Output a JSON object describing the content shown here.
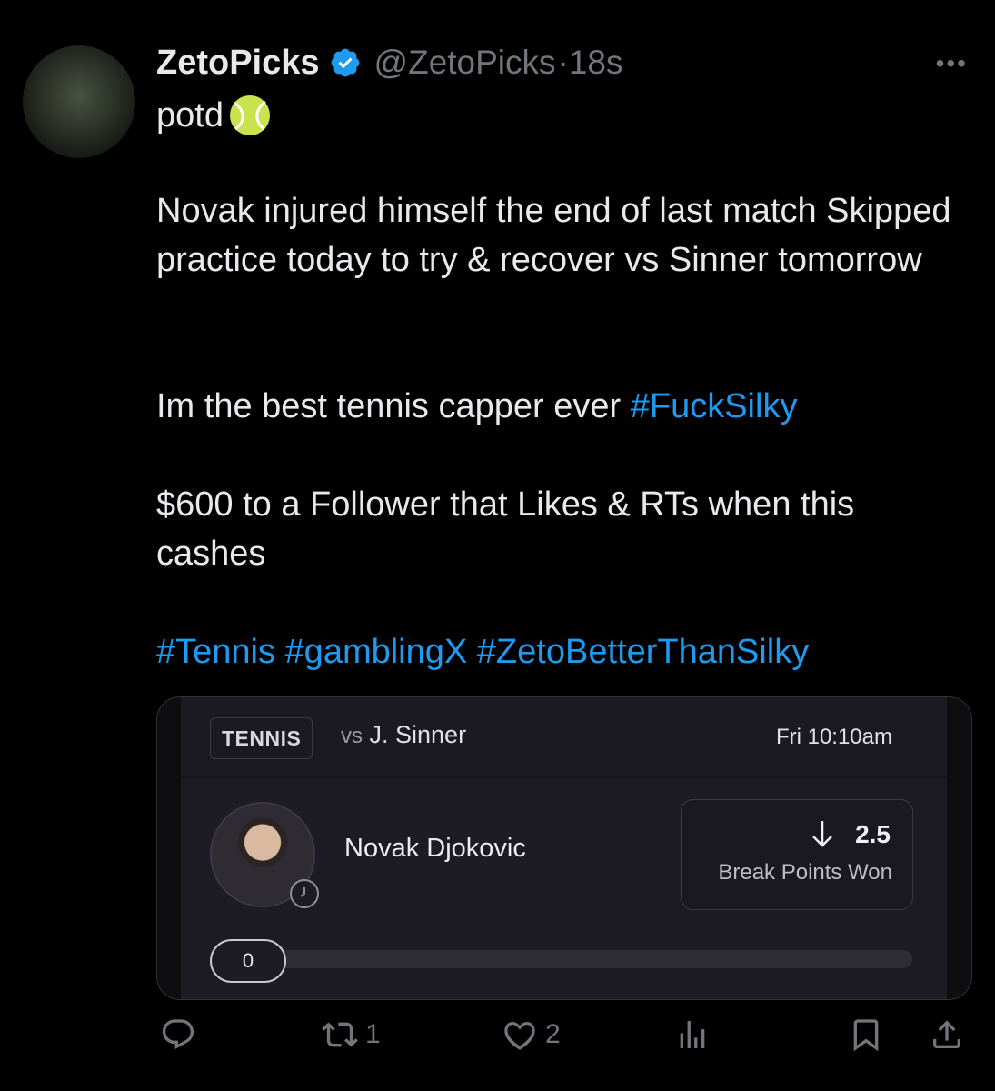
{
  "tweet": {
    "author_name": "ZetoPicks",
    "handle": "@ZetoPicks",
    "time": "·18s",
    "more": "•••",
    "line1": "potd",
    "para1": "Novak injured himself the end of last match Skipped practice today to try & recover  vs Sinner tomorrow",
    "para2_text": "Im the best tennis capper ever ",
    "para2_hashtag": "#FuckSilky",
    "para3": "$600 to a Follower that Likes & RTs when this cashes",
    "hashtags": [
      "#Tennis",
      "#gamblingX",
      "#ZetoBetterThanSilky"
    ]
  },
  "card": {
    "sport": "TENNIS",
    "vs_prefix": "vs",
    "opponent": "J. Sinner",
    "time": "Fri 10:10am",
    "player": "Novak Djokovic",
    "line": "2.5",
    "direction": "under",
    "stat": "Break Points Won",
    "progress_value": "0",
    "progress_fraction": 0
  },
  "actions": {
    "replies": "",
    "retweets": "1",
    "likes": "2",
    "views": ""
  },
  "colors": {
    "background": "#000000",
    "text": "#e7e9ea",
    "muted": "#71767b",
    "link": "#1d9bf0",
    "verified": "#1d9bf0"
  }
}
